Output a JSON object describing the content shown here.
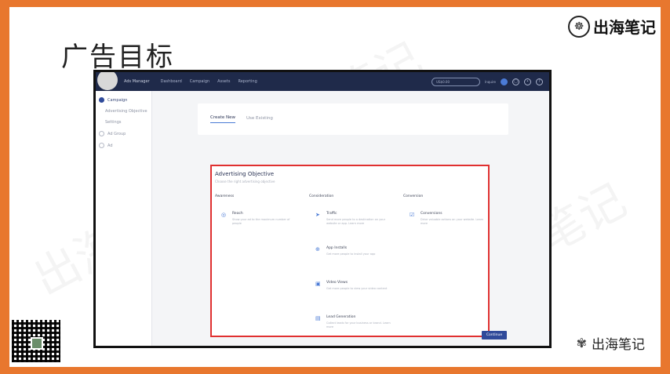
{
  "slide": {
    "title": "广告目标",
    "logo_text": "出海笔记",
    "bottom_brand": "出海笔记"
  },
  "watermarks": [
    "出海笔记",
    "出海笔记",
    "出海笔记"
  ],
  "app": {
    "brand": "Ads Manager",
    "nav": [
      "Dashboard",
      "Campaign",
      "Assets",
      "Reporting"
    ],
    "search_placeholder": "US$0.00",
    "top_right_text": "Inquire",
    "notification_badge": "1"
  },
  "sidebar": {
    "items": [
      {
        "label": "Campaign",
        "active": true
      },
      {
        "label": "Advertising Objective",
        "sub": true
      },
      {
        "label": "Settings",
        "sub": true
      },
      {
        "label": "Ad Group",
        "active": false
      },
      {
        "label": "Ad",
        "active": false
      }
    ]
  },
  "tabs": {
    "create_new": "Create New",
    "use_existing": "Use Existing"
  },
  "objective": {
    "title": "Advertising Objective",
    "subtitle": "Choose the right advertising objective",
    "columns": {
      "awareness": "Awareness",
      "consideration": "Consideration",
      "conversion": "Conversion"
    },
    "options": {
      "reach": {
        "name": "Reach",
        "desc": "Show your ad to the maximum number of people"
      },
      "traffic": {
        "name": "Traffic",
        "desc": "Send more people to a destination on your website or app. Learn more"
      },
      "conversions": {
        "name": "Conversions",
        "desc": "Drive valuable actions on your website. Learn more"
      },
      "app_installs": {
        "name": "App Installs",
        "desc": "Get more people to install your app"
      },
      "video_views": {
        "name": "Video Views",
        "desc": "Get more people to view your video content"
      },
      "lead_generation": {
        "name": "Lead Generation",
        "desc": "Collect leads for your business or brand. Learn more"
      }
    }
  },
  "continue_label": "Continue"
}
